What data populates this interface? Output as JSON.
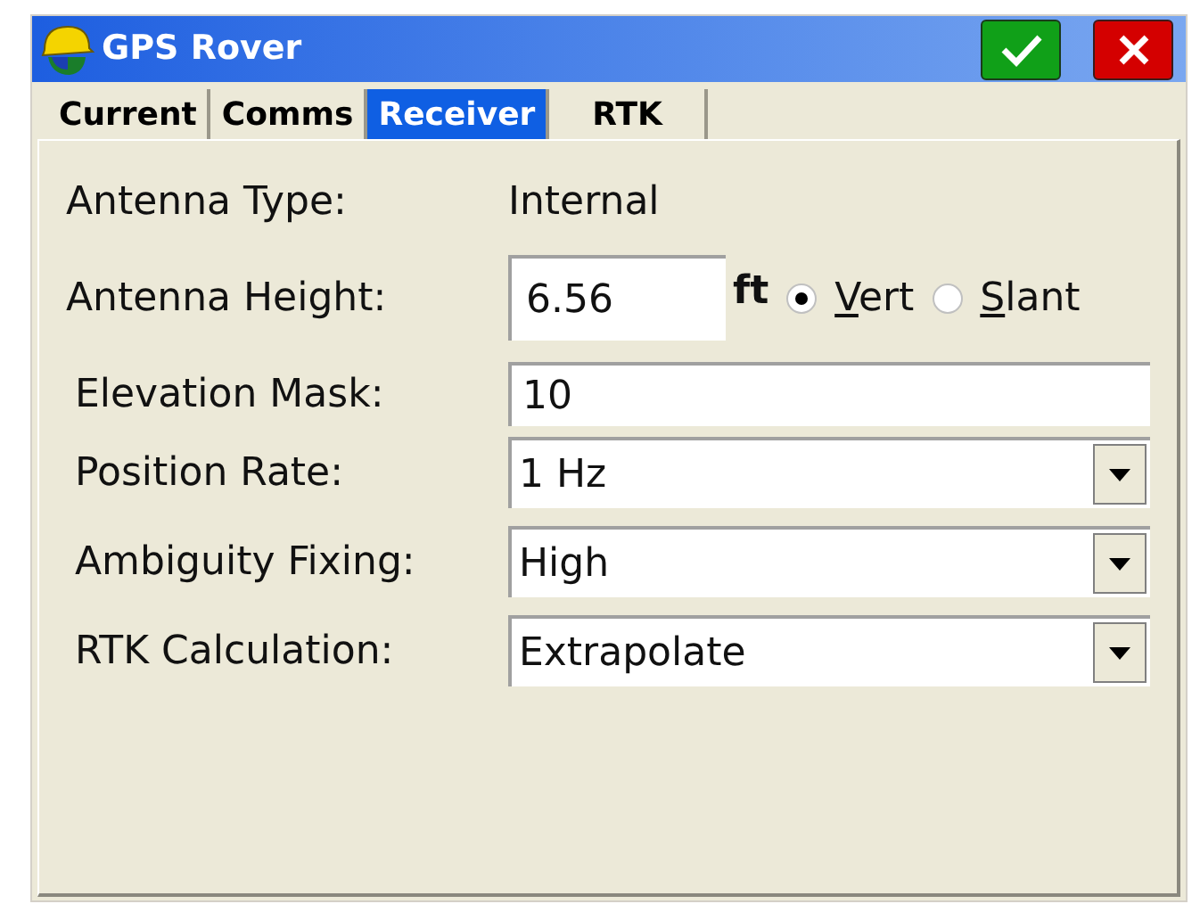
{
  "window": {
    "title": "GPS Rover"
  },
  "tabs": [
    {
      "label": "Current",
      "selected": false
    },
    {
      "label": "Comms",
      "selected": false
    },
    {
      "label": "Receiver",
      "selected": true
    },
    {
      "label": "RTK",
      "selected": false
    }
  ],
  "antenna_type": {
    "label": "Antenna Type:",
    "value": "Internal"
  },
  "antenna_height": {
    "label": "Antenna Height:",
    "value": "6.56",
    "unit": "ft",
    "options": [
      {
        "label": "Vert",
        "selected": true
      },
      {
        "label": "Slant",
        "selected": false
      }
    ]
  },
  "fields": [
    {
      "kind": "text",
      "label": "Elevation Mask:",
      "value": "10"
    },
    {
      "kind": "dropdown",
      "label": "Position Rate:",
      "value": "1 Hz"
    },
    {
      "kind": "dropdown",
      "label": "Ambiguity Fixing:",
      "value": "High"
    },
    {
      "kind": "dropdown",
      "label": "RTK Calculation:",
      "value": "Extrapolate"
    }
  ]
}
